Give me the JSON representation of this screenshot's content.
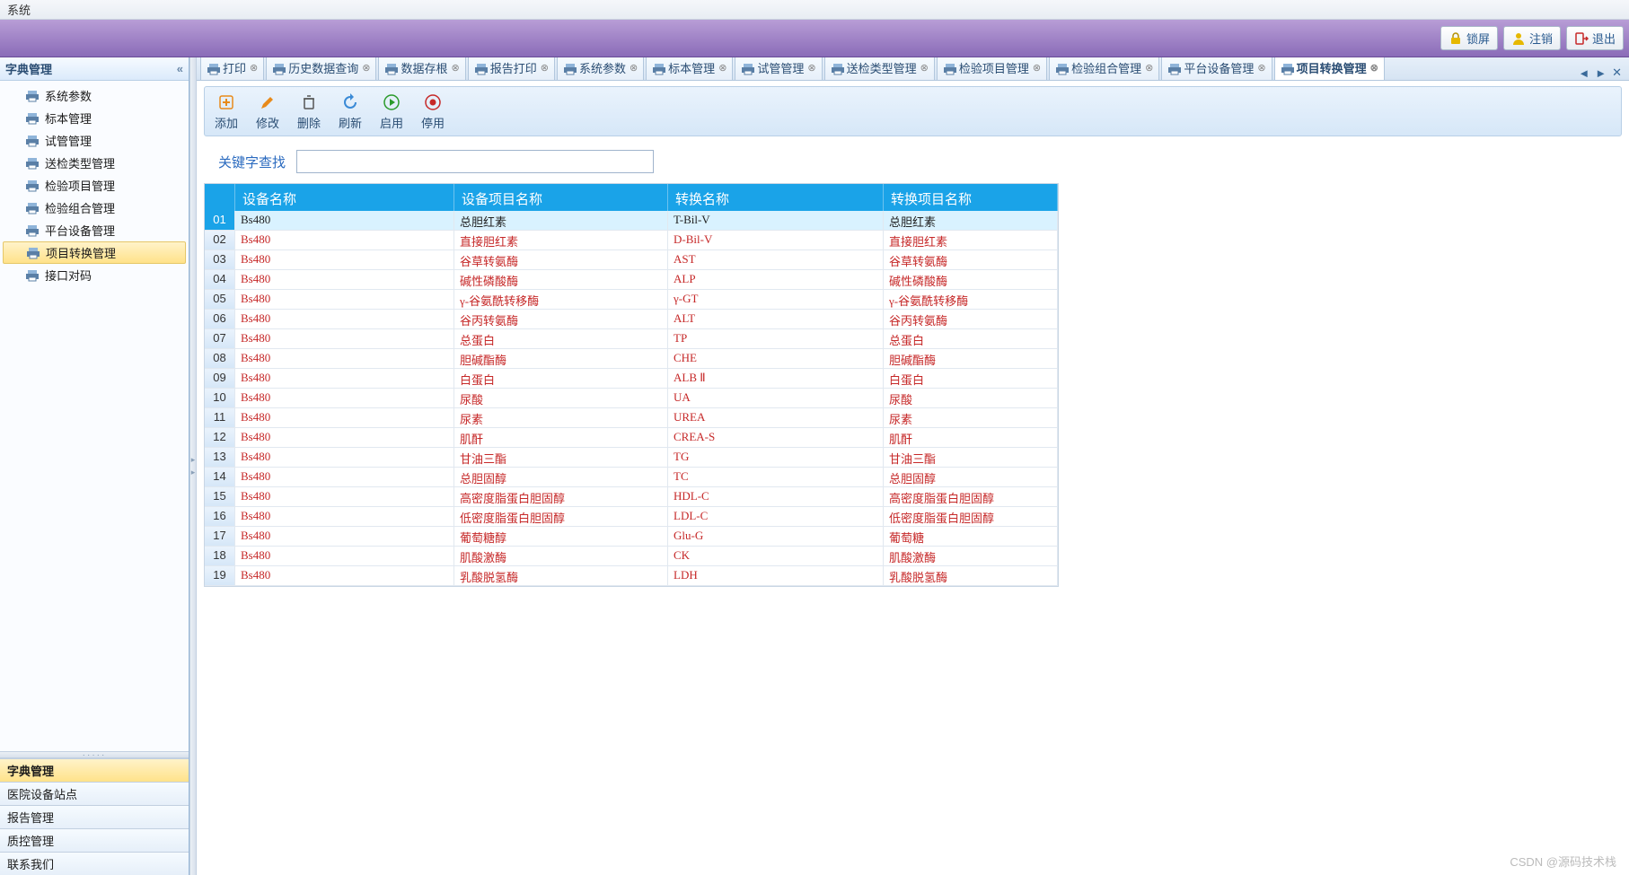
{
  "titlebar": {
    "menu": "系统"
  },
  "ribbon": {
    "lock": "锁屏",
    "logout": "注销",
    "exit": "退出"
  },
  "sidebar": {
    "header": "字典管理",
    "items": [
      {
        "label": "系统参数"
      },
      {
        "label": "标本管理"
      },
      {
        "label": "试管管理"
      },
      {
        "label": "送检类型管理"
      },
      {
        "label": "检验项目管理"
      },
      {
        "label": "检验组合管理"
      },
      {
        "label": "平台设备管理"
      },
      {
        "label": "项目转换管理"
      },
      {
        "label": "接口对码"
      }
    ],
    "selected_index": 7,
    "footer": [
      {
        "label": "字典管理",
        "active": true
      },
      {
        "label": "医院设备站点"
      },
      {
        "label": "报告管理"
      },
      {
        "label": "质控管理"
      },
      {
        "label": "联系我们"
      }
    ]
  },
  "tabs": {
    "items": [
      {
        "label": "打印"
      },
      {
        "label": "历史数据查询"
      },
      {
        "label": "数据存根"
      },
      {
        "label": "报告打印"
      },
      {
        "label": "系统参数"
      },
      {
        "label": "标本管理"
      },
      {
        "label": "试管管理"
      },
      {
        "label": "送检类型管理"
      },
      {
        "label": "检验项目管理"
      },
      {
        "label": "检验组合管理"
      },
      {
        "label": "平台设备管理"
      },
      {
        "label": "项目转换管理"
      }
    ],
    "active_index": 11
  },
  "toolbar": {
    "add": "添加",
    "edit": "修改",
    "del": "删除",
    "refresh": "刷新",
    "enable": "启用",
    "disable": "停用"
  },
  "search": {
    "label": "关键字查找",
    "value": ""
  },
  "table": {
    "headers": {
      "num": "",
      "dev": "设备名称",
      "proj": "设备项目名称",
      "conv": "转换名称",
      "convp": "转换项目名称"
    },
    "rows": [
      {
        "n": "01",
        "dev": "Bs480",
        "proj": "总胆红素",
        "conv": "T-Bil-V",
        "convp": "总胆红素",
        "sel": true
      },
      {
        "n": "02",
        "dev": "Bs480",
        "proj": "直接胆红素",
        "conv": "D-Bil-V",
        "convp": "直接胆红素"
      },
      {
        "n": "03",
        "dev": "Bs480",
        "proj": "谷草转氨酶",
        "conv": "AST",
        "convp": "谷草转氨酶"
      },
      {
        "n": "04",
        "dev": "Bs480",
        "proj": "碱性磷酸酶",
        "conv": "ALP",
        "convp": "碱性磷酸酶"
      },
      {
        "n": "05",
        "dev": "Bs480",
        "proj": "γ-谷氨酰转移酶",
        "conv": "γ-GT",
        "convp": "γ-谷氨酰转移酶"
      },
      {
        "n": "06",
        "dev": "Bs480",
        "proj": "谷丙转氨酶",
        "conv": "ALT",
        "convp": "谷丙转氨酶"
      },
      {
        "n": "07",
        "dev": "Bs480",
        "proj": "总蛋白",
        "conv": "TP",
        "convp": "总蛋白"
      },
      {
        "n": "08",
        "dev": "Bs480",
        "proj": "胆碱酯酶",
        "conv": "CHE",
        "convp": "胆碱酯酶"
      },
      {
        "n": "09",
        "dev": "Bs480",
        "proj": "白蛋白",
        "conv": "ALB Ⅱ",
        "convp": "白蛋白"
      },
      {
        "n": "10",
        "dev": "Bs480",
        "proj": "尿酸",
        "conv": "UA",
        "convp": "尿酸"
      },
      {
        "n": "11",
        "dev": "Bs480",
        "proj": "尿素",
        "conv": "UREA",
        "convp": "尿素"
      },
      {
        "n": "12",
        "dev": "Bs480",
        "proj": "肌酐",
        "conv": "CREA-S",
        "convp": "肌酐"
      },
      {
        "n": "13",
        "dev": "Bs480",
        "proj": "甘油三酯",
        "conv": "TG",
        "convp": "甘油三酯"
      },
      {
        "n": "14",
        "dev": "Bs480",
        "proj": "总胆固醇",
        "conv": "TC",
        "convp": "总胆固醇"
      },
      {
        "n": "15",
        "dev": "Bs480",
        "proj": "高密度脂蛋白胆固醇",
        "conv": "HDL-C",
        "convp": "高密度脂蛋白胆固醇"
      },
      {
        "n": "16",
        "dev": "Bs480",
        "proj": "低密度脂蛋白胆固醇",
        "conv": "LDL-C",
        "convp": "低密度脂蛋白胆固醇"
      },
      {
        "n": "17",
        "dev": "Bs480",
        "proj": "葡萄糖醇",
        "conv": "Glu-G",
        "convp": "葡萄糖"
      },
      {
        "n": "18",
        "dev": "Bs480",
        "proj": "肌酸激酶",
        "conv": "CK",
        "convp": "肌酸激酶"
      },
      {
        "n": "19",
        "dev": "Bs480",
        "proj": "乳酸脱氢酶",
        "conv": "LDH",
        "convp": "乳酸脱氢酶"
      }
    ]
  },
  "watermark": "CSDN @源码技术栈"
}
